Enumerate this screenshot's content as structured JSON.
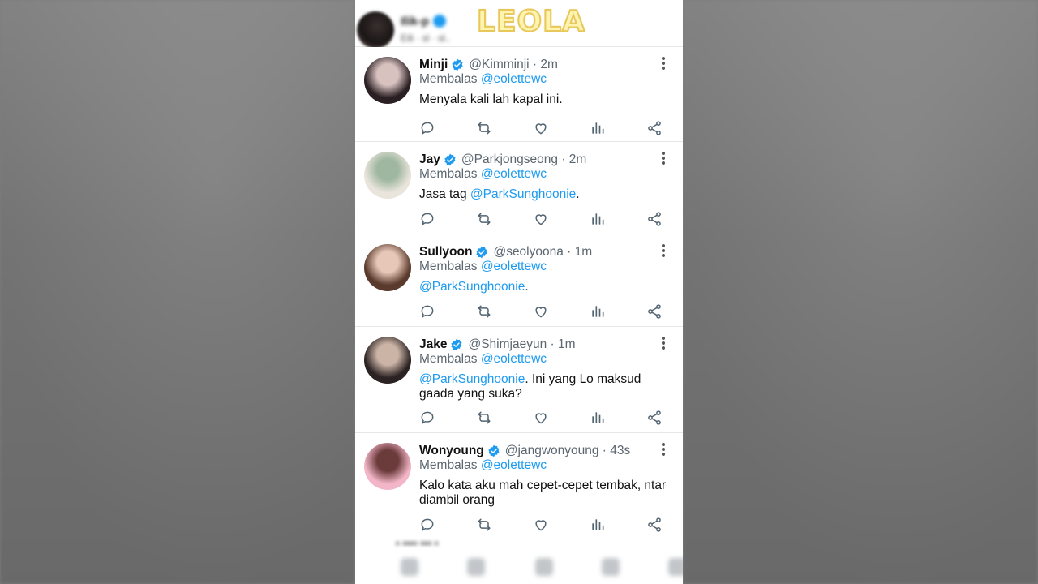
{
  "header": {
    "blurred_name": "Ilik-p",
    "blurred_sub": "Eili · sl · sl..",
    "watermark": "LEOLA"
  },
  "reply_prefix": "Membalas",
  "tweets": [
    {
      "name": "Minji",
      "handle": "@Kimminji · 2m",
      "reply_to": "@eolettewc",
      "text_parts": [
        {
          "t": "Menyala kali lah kapal ini.",
          "mention": false
        }
      ],
      "avatar_colors": [
        "#2a1f22",
        "#d8c2c0"
      ]
    },
    {
      "name": "Jay",
      "handle": "@Parkjongseong · 2m",
      "reply_to": "@eolettewc",
      "text_parts": [
        {
          "t": "Jasa tag ",
          "mention": false
        },
        {
          "t": "@ParkSunghoonie",
          "mention": true
        },
        {
          "t": ".",
          "mention": false
        }
      ],
      "avatar_colors": [
        "#e9e4dc",
        "#9fb7a0"
      ]
    },
    {
      "name": "Sullyoon",
      "handle": "@seolyoona · 1m",
      "reply_to": "@eolettewc",
      "text_parts": [
        {
          "t": "@ParkSunghoonie",
          "mention": true
        },
        {
          "t": ".",
          "mention": false
        }
      ],
      "avatar_colors": [
        "#5a3a2c",
        "#e7c8b8"
      ]
    },
    {
      "name": "Jake",
      "handle": "@Shimjaeyun · 1m",
      "reply_to": "@eolettewc",
      "text_parts": [
        {
          "t": "@ParkSunghoonie",
          "mention": true
        },
        {
          "t": ". Ini yang Lo maksud gaada yang suka?",
          "mention": false
        }
      ],
      "avatar_colors": [
        "#2b2323",
        "#cbb3a6"
      ]
    },
    {
      "name": "Wonyoung",
      "handle": "@jangwonyoung · 43s",
      "reply_to": "@eolettewc",
      "text_parts": [
        {
          "t": "Kalo kata aku mah cepet-cepet tembak, ntar diambil orang",
          "mention": false
        }
      ],
      "avatar_colors": [
        "#f2b6c8",
        "#6b3a3a"
      ]
    }
  ],
  "bottom": {
    "blurred_strip": "▪ ▪▪▪▪ ▪▪▪ ▪"
  },
  "icons": {
    "reply": "reply-icon",
    "retweet": "retweet-icon",
    "like": "like-icon",
    "views": "views-icon",
    "share": "share-icon",
    "verified": "verified-badge-icon",
    "more": "more-options-icon"
  },
  "colors": {
    "accent": "#1d9bf0",
    "text": "#111111",
    "muted": "#5b6670",
    "icon": "#536471"
  }
}
